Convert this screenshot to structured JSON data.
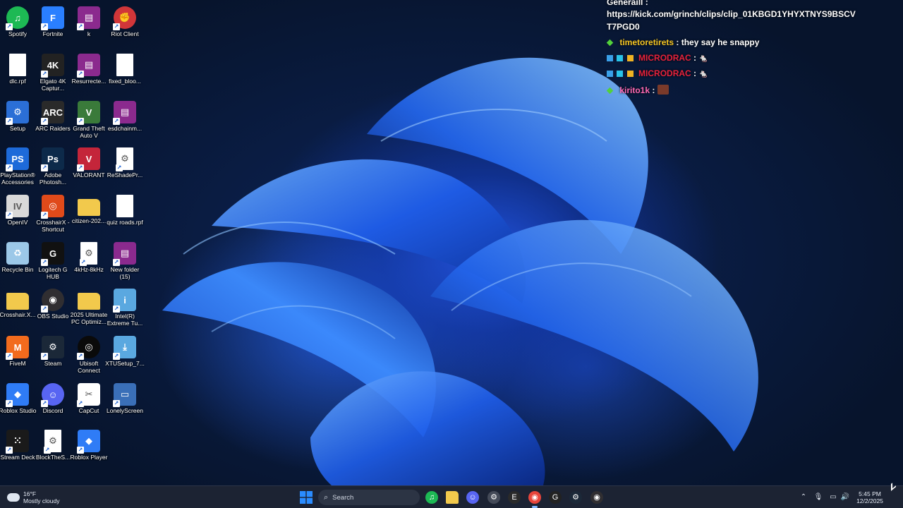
{
  "chat": {
    "header_user": "Generaill :",
    "link_line1": "https://kick.com/grinch/clips/clip_01KBGD1YHYXTNYS9BSCV",
    "link_line2": "T7PGD0",
    "messages": [
      {
        "user": "timetoretirets",
        "text": "they say he snappy",
        "user_color": "#f5c523"
      },
      {
        "user": "MICRODRAC",
        "text": "",
        "user_color": "#e8223c"
      },
      {
        "user": "MICRODRAC",
        "text": "",
        "user_color": "#e8223c"
      },
      {
        "user": "kirito1k",
        "text": "",
        "user_color": "#ff69b4"
      }
    ]
  },
  "desktop_icons": [
    {
      "label": "Spotify",
      "icon": "spotify-icon",
      "color": "#1db954"
    },
    {
      "label": "Fortnite",
      "icon": "fortnite-icon",
      "color": "#2a7fff"
    },
    {
      "label": "k",
      "icon": "winrar-icon",
      "color": "#8b2a8e"
    },
    {
      "label": "Riot Client",
      "icon": "riot-icon",
      "color": "#d13639"
    },
    {
      "label": "dlc.rpf",
      "icon": "file-icon",
      "color": "#ffffff"
    },
    {
      "label": "Elgato 4K Captur...",
      "icon": "elgato-icon",
      "color": "#222222"
    },
    {
      "label": "Resurrecte...",
      "icon": "winrar-icon",
      "color": "#8b2a8e"
    },
    {
      "label": "fixed_bloo...",
      "icon": "file-icon",
      "color": "#ffffff"
    },
    {
      "label": "Setup",
      "icon": "setup-icon",
      "color": "#2b6fd6"
    },
    {
      "label": "ARC Raiders",
      "icon": "arc-raiders-icon",
      "color": "#2a2a2a"
    },
    {
      "label": "Grand Theft Auto V",
      "icon": "gta-icon",
      "color": "#3a7a3a"
    },
    {
      "label": "esdchainm...",
      "icon": "winrar-icon",
      "color": "#8b2a8e"
    },
    {
      "label": "PlayStation® Accessories",
      "icon": "playstation-icon",
      "color": "#1d6ad9"
    },
    {
      "label": "Adobe Photosh...",
      "icon": "photoshop-icon",
      "color": "#0d2a4a"
    },
    {
      "label": "VALORANT",
      "icon": "valorant-icon",
      "color": "#c4253a"
    },
    {
      "label": "ReShadePr...",
      "icon": "file-gear-icon",
      "color": "#ffffff"
    },
    {
      "label": "OpenIV",
      "icon": "openiv-icon",
      "color": "#d9d9d9"
    },
    {
      "label": "CrosshairX - Shortcut",
      "icon": "crosshairx-icon",
      "color": "#e04a1a"
    },
    {
      "label": "citizen-202...",
      "icon": "folder-icon",
      "color": "#f2c94c"
    },
    {
      "label": "quiz roads.rpf",
      "icon": "file-icon",
      "color": "#ffffff"
    },
    {
      "label": "Recycle Bin",
      "icon": "recycle-bin-icon",
      "color": "#9cc8e8"
    },
    {
      "label": "Logitech G HUB",
      "icon": "logitech-icon",
      "color": "#111111"
    },
    {
      "label": "4kHz-8kHz",
      "icon": "file-gear-icon",
      "color": "#ffffff"
    },
    {
      "label": "New folder (15)",
      "icon": "winrar-icon",
      "color": "#8b2a8e"
    },
    {
      "label": "Crosshair.X...",
      "icon": "folder-icon",
      "color": "#f2c94c"
    },
    {
      "label": "OBS Studio",
      "icon": "obs-icon",
      "color": "#302e31"
    },
    {
      "label": "2025 Ultimate PC Optimiz...",
      "icon": "folder-icon",
      "color": "#f2c94c"
    },
    {
      "label": "Intel(R) Extreme Tu...",
      "icon": "intel-icon",
      "color": "#5aa8e0"
    },
    {
      "label": "FiveM",
      "icon": "fivem-icon",
      "color": "#f26b1d"
    },
    {
      "label": "Steam",
      "icon": "steam-icon",
      "color": "#1b2838"
    },
    {
      "label": "Ubisoft Connect",
      "icon": "ubisoft-icon",
      "color": "#0a0a0a"
    },
    {
      "label": "XTUSetup_7...",
      "icon": "installer-icon",
      "color": "#5aa8e0"
    },
    {
      "label": "Roblox Studio",
      "icon": "roblox-studio-icon",
      "color": "#2f7cf6"
    },
    {
      "label": "Discord",
      "icon": "discord-icon",
      "color": "#5865f2"
    },
    {
      "label": "CapCut",
      "icon": "capcut-icon",
      "color": "#ffffff"
    },
    {
      "label": "LonelyScreen",
      "icon": "lonelyscreen-icon",
      "color": "#3a6fb8"
    },
    {
      "label": "Stream Deck",
      "icon": "stream-deck-icon",
      "color": "#1a1a1a"
    },
    {
      "label": "BlockTheS...",
      "icon": "file-gear-icon",
      "color": "#ffffff"
    },
    {
      "label": "Roblox Player",
      "icon": "roblox-icon",
      "color": "#2f7cf6"
    }
  ],
  "taskbar": {
    "weather_temp": "16°F",
    "weather_desc": "Mostly cloudy",
    "search_placeholder": "Search",
    "time": "5:45 PM",
    "date": "12/2/2025",
    "pinned": [
      {
        "name": "start-button",
        "icon": "windows-icon",
        "color": "#2a8cff"
      },
      {
        "name": "taskbar-spotify",
        "icon": "spotify-icon",
        "color": "#1db954"
      },
      {
        "name": "taskbar-file-explorer",
        "icon": "folder-icon",
        "color": "#f2c94c"
      },
      {
        "name": "taskbar-discord",
        "icon": "discord-icon",
        "color": "#5865f2"
      },
      {
        "name": "taskbar-steam-alt",
        "icon": "app-icon",
        "color": "#444a58"
      },
      {
        "name": "taskbar-epic",
        "icon": "epic-games-icon",
        "color": "#2a2a2a"
      },
      {
        "name": "taskbar-chrome",
        "icon": "chrome-icon",
        "color": "#e8453c"
      },
      {
        "name": "taskbar-logitech",
        "icon": "logitech-icon",
        "color": "#222222"
      },
      {
        "name": "taskbar-steam",
        "icon": "steam-icon",
        "color": "#1b2838"
      },
      {
        "name": "taskbar-obs",
        "icon": "obs-icon",
        "color": "#302e31"
      }
    ]
  }
}
